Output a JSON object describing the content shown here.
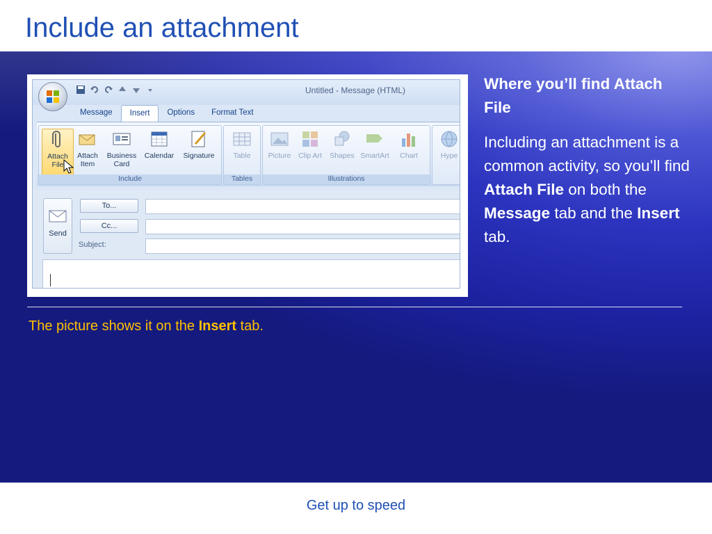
{
  "slide": {
    "title": "Include an attachment",
    "footer": "Get up to speed"
  },
  "screenshot": {
    "window_title": "Untitled - Message (HTML)",
    "tabs": [
      "Message",
      "Insert",
      "Options",
      "Format Text"
    ],
    "active_tab": "Insert",
    "ribbon_groups": {
      "include": {
        "label": "Include",
        "buttons": [
          "Attach File",
          "Attach Item",
          "Business Card",
          "Calendar",
          "Signature"
        ]
      },
      "tables": {
        "label": "Tables",
        "buttons": [
          "Table"
        ]
      },
      "illustrations": {
        "label": "Illustrations",
        "buttons": [
          "Picture",
          "Clip Art",
          "Shapes",
          "SmartArt",
          "Chart"
        ]
      },
      "links_partial": "Hype"
    },
    "send_label": "Send",
    "to_label": "To...",
    "cc_label": "Cc...",
    "subject_label": "Subject:"
  },
  "side_text": {
    "heading": "Where you’ll find Attach File",
    "body_1": "Including an attachment is a common activity, so you’ll find ",
    "body_b1": "Attach File",
    "body_2": " on both the ",
    "body_b2": "Message",
    "body_3": " tab and the ",
    "body_b3": "Insert",
    "body_4": " tab."
  },
  "caption": {
    "pre": "The picture shows it on the ",
    "bold": "Insert",
    "post": " tab."
  },
  "colors": {
    "title_blue": "#1f4fb4",
    "caption_gold": "#ffc000",
    "panel_blue": "#2c34bf"
  }
}
